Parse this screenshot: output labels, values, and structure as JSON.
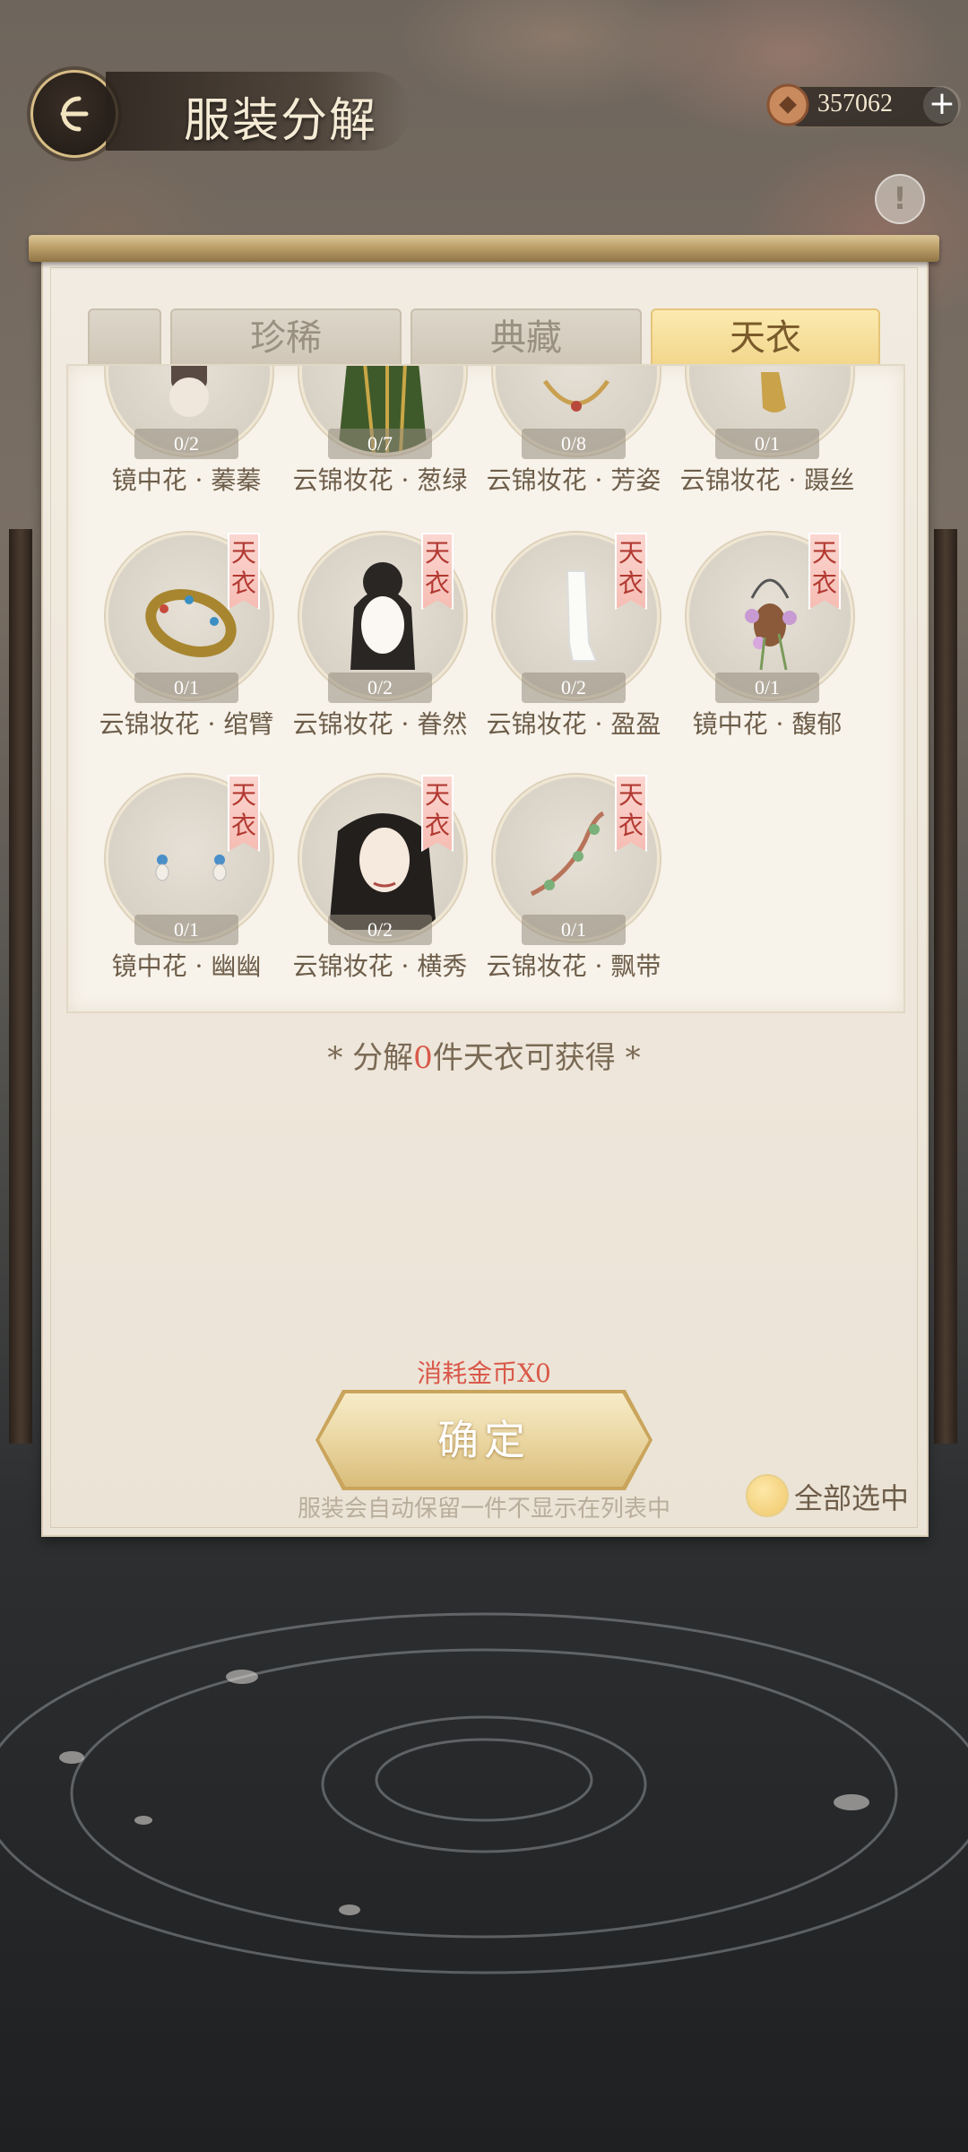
{
  "header": {
    "title": "服装分解",
    "coins": "357062",
    "plus_symbol": "+",
    "info_symbol": "!"
  },
  "tabs": [
    {
      "label": ""
    },
    {
      "label": "珍稀"
    },
    {
      "label": "典藏"
    },
    {
      "label": "天衣"
    }
  ],
  "active_tab": "天衣",
  "items": [
    {
      "name": "镜中花 · 蓁蓁",
      "count": "0/2",
      "tag": ""
    },
    {
      "name": "云锦妆花 · 葱绿",
      "count": "0/7",
      "tag": ""
    },
    {
      "name": "云锦妆花 · 芳姿",
      "count": "0/8",
      "tag": ""
    },
    {
      "name": "云锦妆花 · 蹑丝",
      "count": "0/1",
      "tag": ""
    },
    {
      "name": "云锦妆花 · 绾臂",
      "count": "0/1",
      "tag": "天衣"
    },
    {
      "name": "云锦妆花 · 眷然",
      "count": "0/2",
      "tag": "天衣"
    },
    {
      "name": "云锦妆花 · 盈盈",
      "count": "0/2",
      "tag": "天衣"
    },
    {
      "name": "镜中花 · 馥郁",
      "count": "0/1",
      "tag": "天衣"
    },
    {
      "name": "镜中花 · 幽幽",
      "count": "0/1",
      "tag": "天衣"
    },
    {
      "name": "云锦妆花 · 横秀",
      "count": "0/2",
      "tag": "天衣"
    },
    {
      "name": "云锦妆花 · 飘带",
      "count": "0/1",
      "tag": "天衣"
    }
  ],
  "summary": {
    "prefix": "*  分解",
    "count": "0",
    "suffix": "件天衣可获得  *"
  },
  "cost_text": "消耗金币X0",
  "confirm_label": "确定",
  "note": "服装会自动保留一件不显示在列表中",
  "select_all_label": "全部选中"
}
